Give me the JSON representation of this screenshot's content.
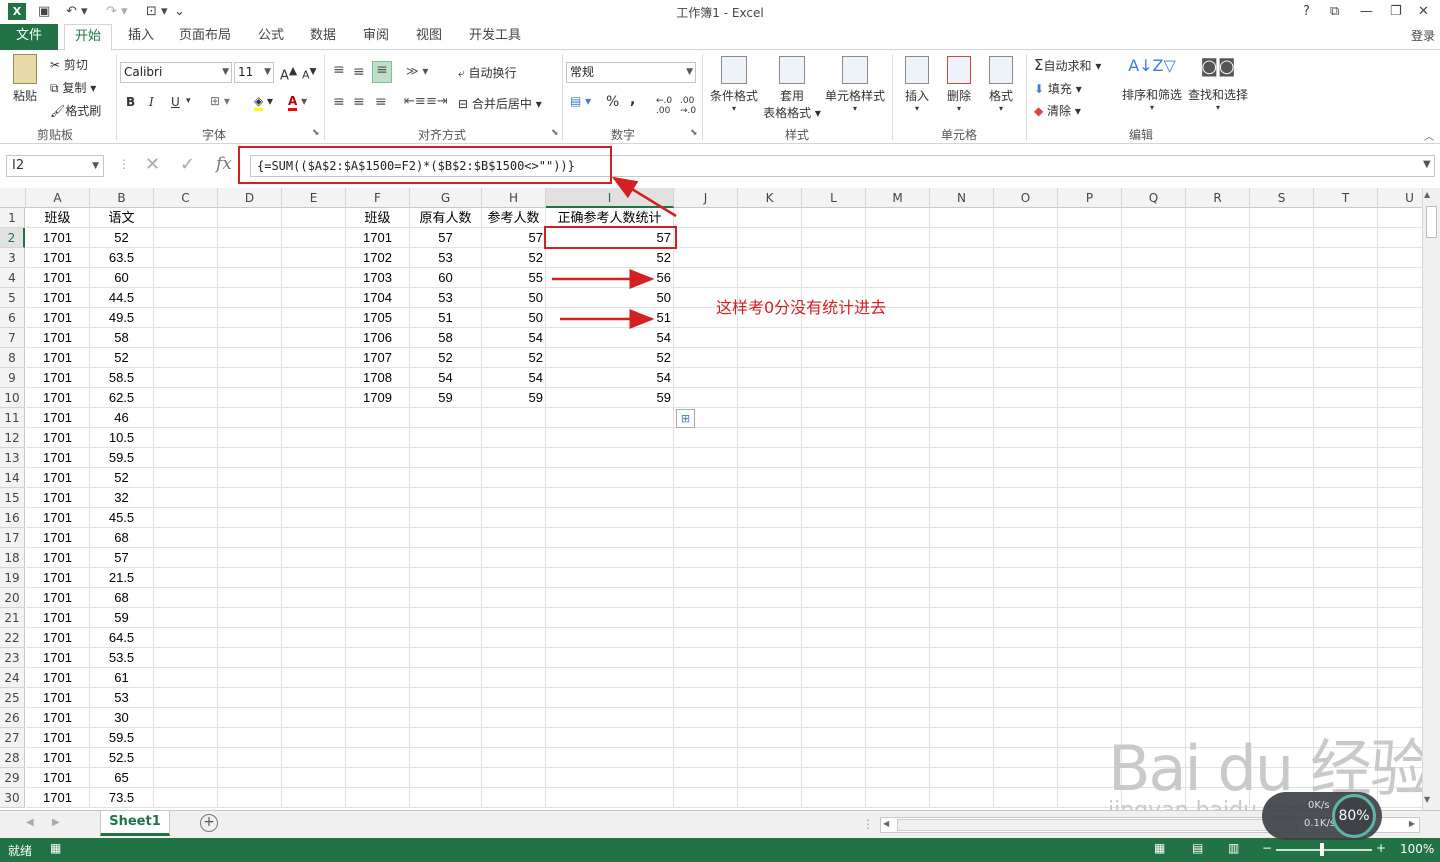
{
  "window": {
    "title": "工作簿1 - Excel",
    "help": "?",
    "login": "登录"
  },
  "tabs": [
    "文件",
    "开始",
    "插入",
    "页面布局",
    "公式",
    "数据",
    "审阅",
    "视图",
    "开发工具"
  ],
  "ribbon": {
    "clipboard": {
      "paste": "粘贴",
      "cut": "剪切",
      "copy": "复制",
      "painter": "格式刷",
      "label": "剪贴板"
    },
    "font": {
      "name": "Calibri",
      "size": "11",
      "bold": "B",
      "italic": "I",
      "underline": "U",
      "label": "字体"
    },
    "align": {
      "wrap": "自动换行",
      "merge": "合并后居中",
      "label": "对齐方式"
    },
    "number": {
      "format": "常规",
      "percent": "%",
      "comma": ",",
      "label": "数字"
    },
    "styles": {
      "cond": "条件格式",
      "table1": "套用",
      "table2": "表格格式",
      "cell": "单元格样式",
      "label": "样式"
    },
    "cells": {
      "insert": "插入",
      "delete": "删除",
      "format": "格式",
      "label": "单元格"
    },
    "edit": {
      "autosum": "自动求和",
      "fill": "填充",
      "clear": "清除",
      "sort": "排序和筛选",
      "find": "查找和选择",
      "label": "编辑"
    }
  },
  "formula_bar": {
    "name_box": "I2",
    "fx": "fx",
    "formula": "{=SUM(($A$2:$A$1500=F2)*($B$2:$B$1500<>\"\"))}"
  },
  "columns": [
    "A",
    "B",
    "C",
    "D",
    "E",
    "F",
    "G",
    "H",
    "I",
    "J",
    "K",
    "L",
    "M",
    "N",
    "O",
    "P",
    "Q",
    "R",
    "S",
    "T",
    "U"
  ],
  "rows": [
    "1",
    "2",
    "3",
    "4",
    "5",
    "6",
    "7",
    "8",
    "9",
    "10",
    "11",
    "12",
    "13",
    "14",
    "15",
    "16",
    "17",
    "18",
    "19",
    "20",
    "21",
    "22",
    "23",
    "24",
    "25",
    "26",
    "27",
    "28",
    "29",
    "30"
  ],
  "sheet": {
    "A1": "班级",
    "B1": "语文",
    "A_values": [
      "1701",
      "1701",
      "1701",
      "1701",
      "1701",
      "1701",
      "1701",
      "1701",
      "1701",
      "1701",
      "1701",
      "1701",
      "1701",
      "1701",
      "1701",
      "1701",
      "1701",
      "1701",
      "1701",
      "1701",
      "1701",
      "1701",
      "1701",
      "1701",
      "1701",
      "1701",
      "1701",
      "1701",
      "1701"
    ],
    "B_values": [
      "52",
      "63.5",
      "60",
      "44.5",
      "49.5",
      "58",
      "52",
      "58.5",
      "62.5",
      "46",
      "10.5",
      "59.5",
      "52",
      "32",
      "45.5",
      "68",
      "57",
      "21.5",
      "68",
      "59",
      "64.5",
      "53.5",
      "61",
      "53",
      "30",
      "59.5",
      "52.5",
      "65",
      "73.5"
    ],
    "F1": "班级",
    "G1": "原有人数",
    "H1": "参考人数",
    "I1": "正确参考人数统计",
    "F_values": [
      "1701",
      "1702",
      "1703",
      "1704",
      "1705",
      "1706",
      "1707",
      "1708",
      "1709"
    ],
    "G_values": [
      "57",
      "53",
      "60",
      "53",
      "51",
      "58",
      "52",
      "54",
      "59"
    ],
    "H_values": [
      "57",
      "52",
      "55",
      "50",
      "50",
      "54",
      "52",
      "54",
      "59"
    ],
    "I_values": [
      "57",
      "52",
      "56",
      "50",
      "51",
      "54",
      "52",
      "54",
      "59"
    ]
  },
  "annotation": "这样考0分没有统计进去",
  "sheet_tab": "Sheet1",
  "status": {
    "ready": "就绪",
    "zoom": "100%"
  },
  "watermark": {
    "brand": "Bai du 经验",
    "url": "jingyan.baidu.com"
  },
  "net_widget": {
    "up": "0K/s",
    "down": "0.1K/s",
    "pct": "80%"
  },
  "colors": {
    "excel_green": "#217346",
    "annot_red": "#d42020"
  }
}
